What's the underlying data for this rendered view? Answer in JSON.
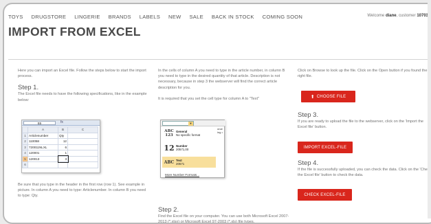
{
  "nav": {
    "items": [
      "TOYS",
      "DRUGSTORE",
      "LINGERIE",
      "BRANDS",
      "LABELS",
      "NEW",
      "SALE",
      "BACK IN STOCK",
      "COMING SOON"
    ],
    "welcome_prefix": "Welcome",
    "user_name": "diane",
    "welcome_middle": ", customer",
    "customer_number": "10703"
  },
  "page": {
    "title": "IMPORT FROM EXCEL"
  },
  "col1": {
    "intro": "Here you can import an Excel file. Follow the steps below to start the import process.",
    "step1_heading": "Step 1.",
    "step1_text": "The Excel file needs to have the following specifications, like in the example below:",
    "footer_text": "Be sure that you type in the header in the first row (row 1). See example in picture. In column A you need to type: Articlenumber. In column B you need to type: Qty."
  },
  "spreadsheet": {
    "name_box": "B5",
    "fx_symbol": "fx",
    "columns": [
      "A",
      "B",
      "C"
    ],
    "rows": [
      {
        "n": "1",
        "a": "Articlenumber",
        "b": "Qty"
      },
      {
        "n": "2",
        "a": "110058",
        "b": "12"
      },
      {
        "n": "3",
        "a": "720011NLXL",
        "b": "6"
      },
      {
        "n": "4",
        "a": "120001",
        "b": "1"
      },
      {
        "n": "5",
        "a": "120013",
        "b": "3"
      },
      {
        "n": "6",
        "a": "",
        "b": ""
      }
    ]
  },
  "col2": {
    "para1": "In the cells of column A you need to type in the article number, in column B you need to type in the desired quantity of that article. Description is not necessary, because in step 3 the webserver will find the correct article description for you.",
    "para2": "It is required that you set the cell type for column A to \"Text\"",
    "step2_heading": "Step 2.",
    "step2_text": "Find the Excel file on your computer. You can use both Microsoft Excel 2007-2013 (*.xlsx) or Microsoft Excel 97-2003 (*.xls) file types."
  },
  "format_menu": {
    "side_text_1": "onal",
    "side_text_2": "ing •",
    "items": [
      {
        "glyph": "ABC 123",
        "name": "General",
        "sub": "No specific format"
      },
      {
        "glyph": "12",
        "name": "Number",
        "sub": "20571,00"
      },
      {
        "glyph": "ABC",
        "name": "Text",
        "sub": "20571"
      }
    ],
    "more": "More Number Formats..."
  },
  "col3": {
    "intro": "Click on Browse to look up the file. Click on the Open button if you found the right file.",
    "choose_label": "CHOOSE FILE",
    "step3_heading": "Step 3.",
    "step3_text": "If you are ready to upload the file to the webserver, click on the 'Import the Excel file' button.",
    "import_label": "IMPORT EXCEL-FILE",
    "step4_heading": "Step 4.",
    "step4_text": "If the file is successfully uploaded, you can check the data. Click on the 'Check the Excel file' button to check the data.",
    "check_label": "CHECK EXCEL-FILE"
  },
  "colors": {
    "accent": "#d9261c",
    "frame_border": "#b9b9b9",
    "text": "#707070"
  }
}
